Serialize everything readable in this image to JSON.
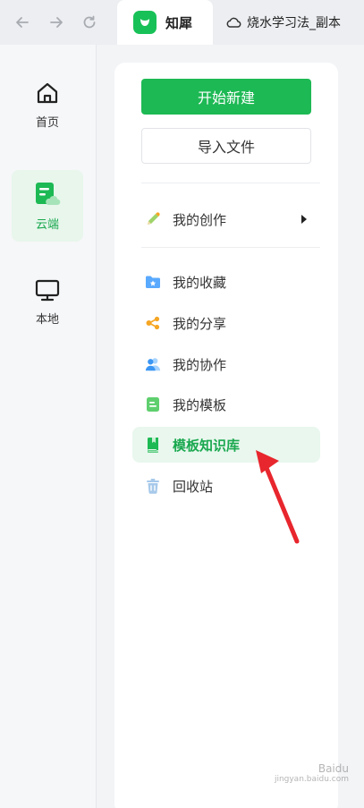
{
  "topbar": {
    "app_tab_title": "知犀",
    "doc_tab_title": "烧水学习法_副本"
  },
  "rail": {
    "items": [
      {
        "label": "首页",
        "icon": "home-icon"
      },
      {
        "label": "云端",
        "icon": "cloud-doc-icon",
        "active": true
      },
      {
        "label": "本地",
        "icon": "monitor-icon"
      }
    ]
  },
  "panel": {
    "new_button": "开始新建",
    "import_button": "导入文件",
    "my_creations": "我的创作",
    "menu": [
      {
        "label": "我的收藏",
        "icon": "favorites-folder-icon"
      },
      {
        "label": "我的分享",
        "icon": "share-icon"
      },
      {
        "label": "我的协作",
        "icon": "collaboration-icon"
      },
      {
        "label": "我的模板",
        "icon": "template-icon"
      },
      {
        "label": "模板知识库",
        "icon": "knowledge-book-icon",
        "active": true
      },
      {
        "label": "回收站",
        "icon": "trash-icon"
      }
    ]
  },
  "colors": {
    "brand_green": "#1db954",
    "active_bg": "#e9f7ee",
    "annotation_red": "#e8262d"
  },
  "watermark": {
    "brand": "Baidu",
    "sub": "jingyan.baidu.com"
  }
}
